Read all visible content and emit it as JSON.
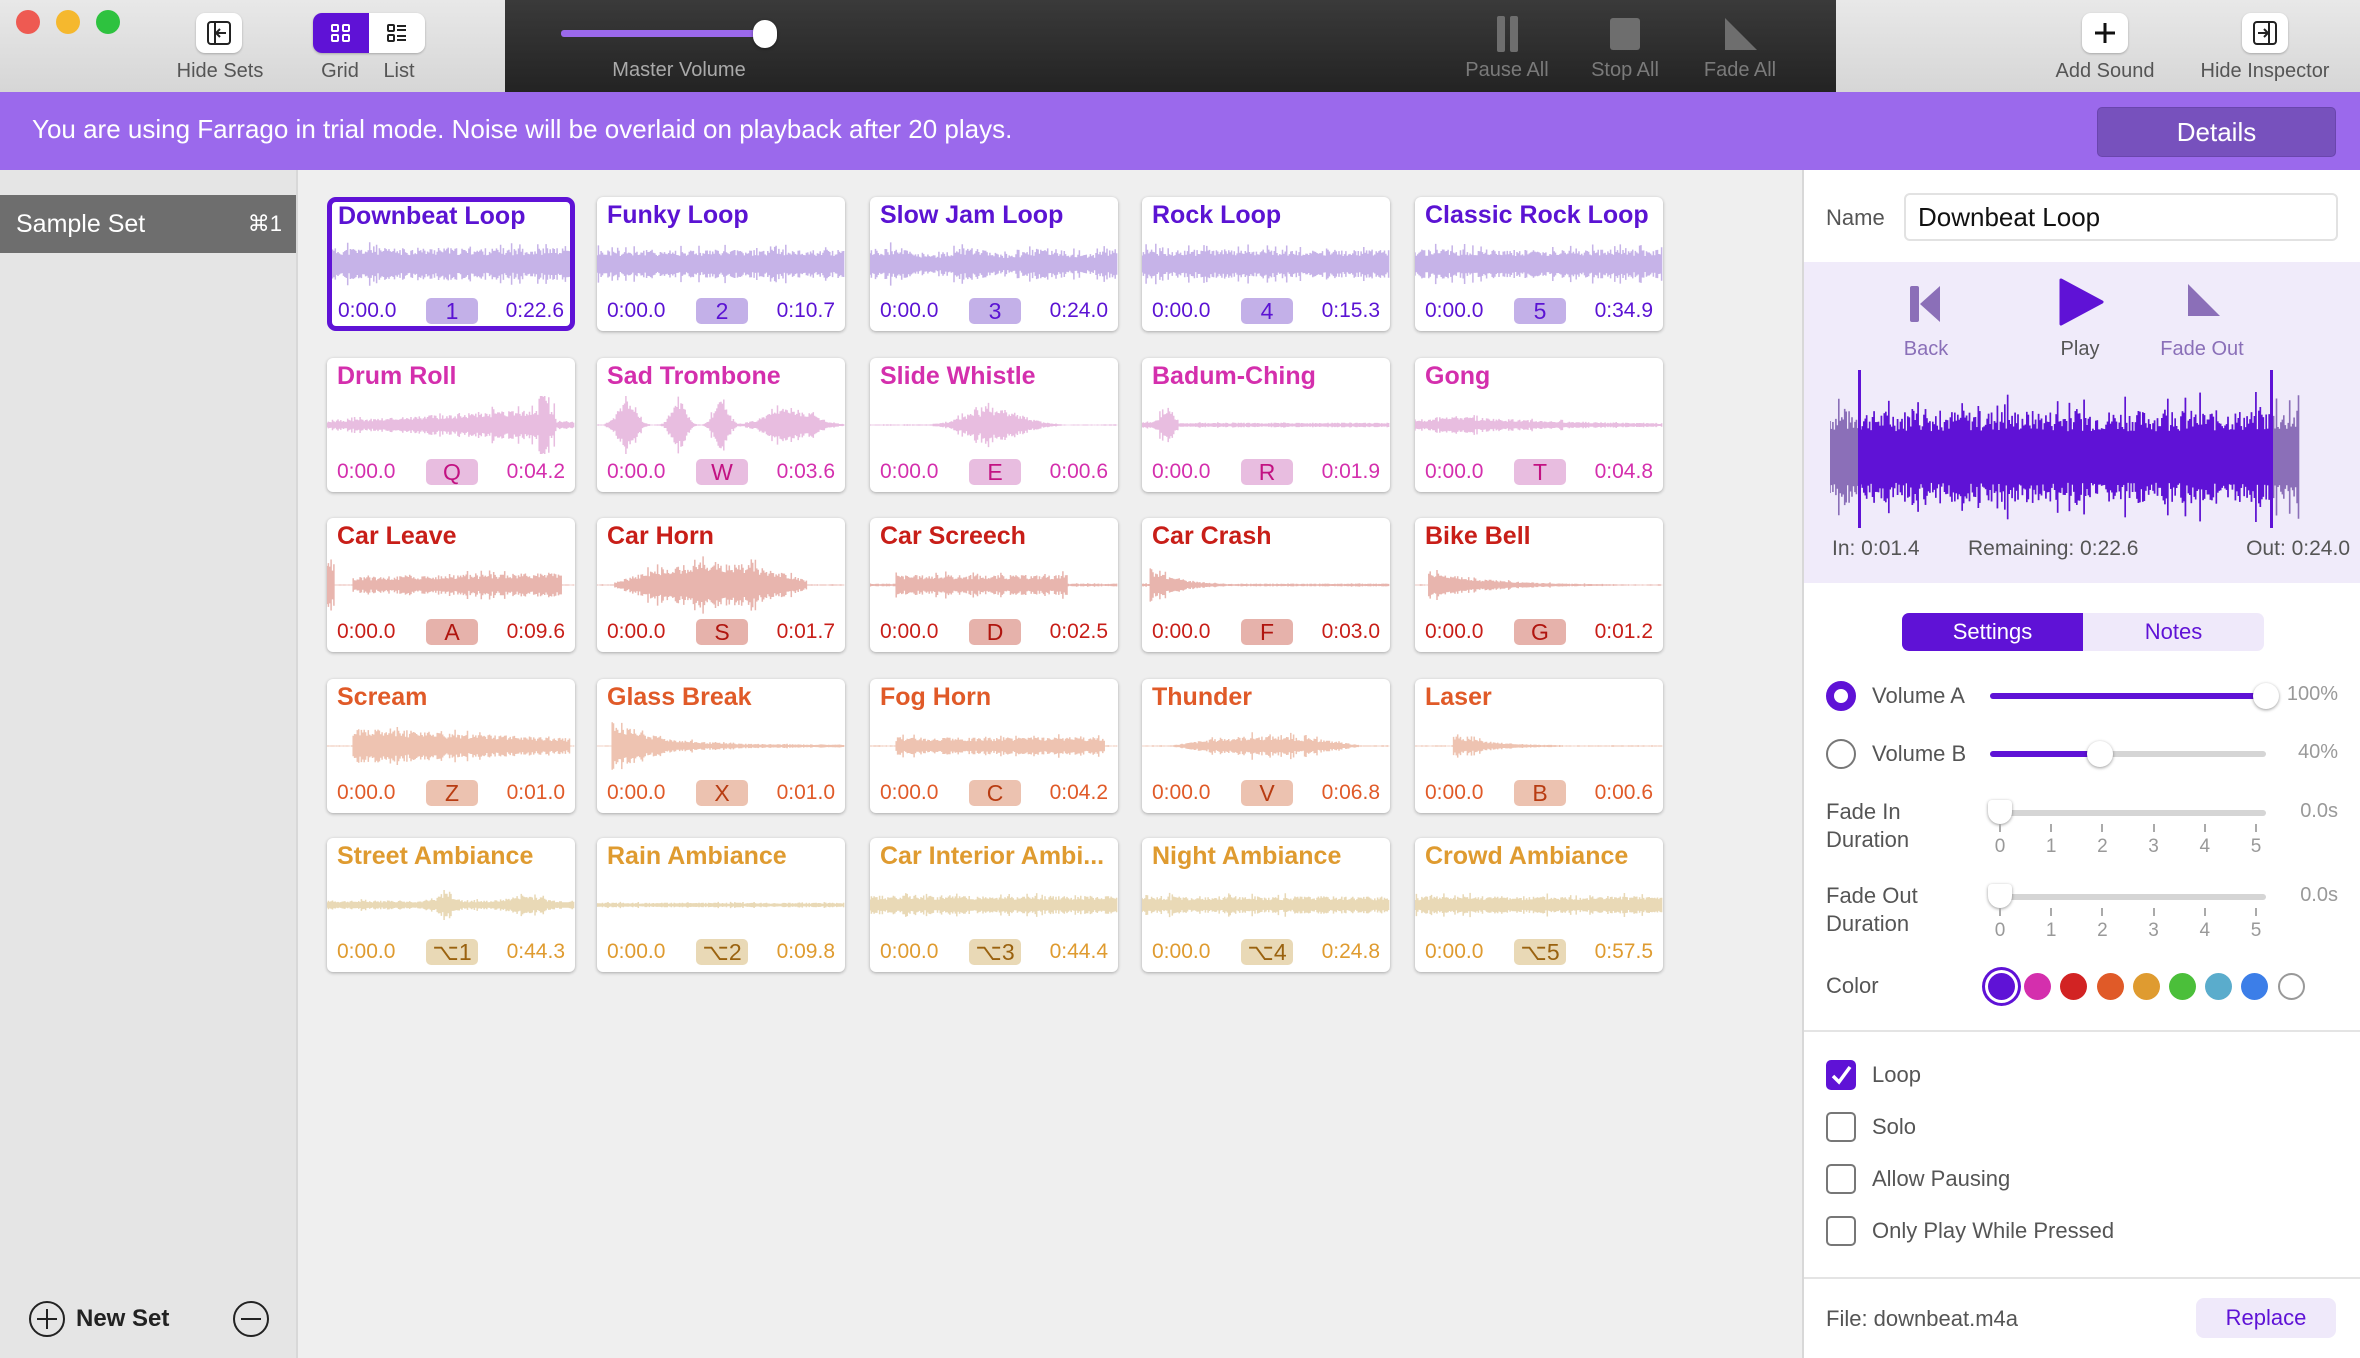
{
  "toolbar": {
    "hide_sets": "Hide Sets",
    "grid": "Grid",
    "list": "List",
    "master_volume": "Master Volume",
    "master_volume_value": 0.95,
    "pause_all": "Pause All",
    "stop_all": "Stop All",
    "fade_all": "Fade All",
    "add_sound": "Add Sound",
    "hide_inspector": "Hide Inspector"
  },
  "banner": {
    "text": "You are using Farrago in trial mode. Noise will be overlaid on playback after 20 plays.",
    "details": "Details"
  },
  "sidebar": {
    "sets": [
      {
        "name": "Sample Set",
        "shortcut": "⌘1"
      }
    ],
    "new_set": "New Set"
  },
  "colors": {
    "purple": {
      "text": "#5b13d3",
      "wave": "#c6b3e8",
      "key": "#c3b0e8",
      "keytext": "#5b13d3"
    },
    "pink": {
      "text": "#d42fad",
      "wave": "#e8bde0",
      "key": "#e8bde0",
      "keytext": "#c21282"
    },
    "red": {
      "text": "#c81e18",
      "wave": "#e8b5ae",
      "key": "#e6b2ab",
      "keytext": "#b0150f"
    },
    "orange": {
      "text": "#e05a28",
      "wave": "#eec3b1",
      "key": "#ecc2b0",
      "keytext": "#b83c12"
    },
    "yellow": {
      "text": "#df9b30",
      "wave": "#e9d9b6",
      "key": "#e9d9b6",
      "keytext": "#9a620f"
    }
  },
  "sounds": [
    {
      "name": "Downbeat Loop",
      "start": "0:00.0",
      "key": "1",
      "end": "0:22.6",
      "color": "purple",
      "selected": true
    },
    {
      "name": "Funky Loop",
      "start": "0:00.0",
      "key": "2",
      "end": "0:10.7",
      "color": "purple"
    },
    {
      "name": "Slow Jam Loop",
      "start": "0:00.0",
      "key": "3",
      "end": "0:24.0",
      "color": "purple"
    },
    {
      "name": "Rock Loop",
      "start": "0:00.0",
      "key": "4",
      "end": "0:15.3",
      "color": "purple"
    },
    {
      "name": "Classic Rock Loop",
      "start": "0:00.0",
      "key": "5",
      "end": "0:34.9",
      "color": "purple"
    },
    {
      "name": "Drum Roll",
      "start": "0:00.0",
      "key": "Q",
      "end": "0:04.2",
      "color": "pink"
    },
    {
      "name": "Sad Trombone",
      "start": "0:00.0",
      "key": "W",
      "end": "0:03.6",
      "color": "pink"
    },
    {
      "name": "Slide Whistle",
      "start": "0:00.0",
      "key": "E",
      "end": "0:00.6",
      "color": "pink"
    },
    {
      "name": "Badum-Ching",
      "start": "0:00.0",
      "key": "R",
      "end": "0:01.9",
      "color": "pink"
    },
    {
      "name": "Gong",
      "start": "0:00.0",
      "key": "T",
      "end": "0:04.8",
      "color": "pink"
    },
    {
      "name": "Car Leave",
      "start": "0:00.0",
      "key": "A",
      "end": "0:09.6",
      "color": "red"
    },
    {
      "name": "Car Horn",
      "start": "0:00.0",
      "key": "S",
      "end": "0:01.7",
      "color": "red"
    },
    {
      "name": "Car Screech",
      "start": "0:00.0",
      "key": "D",
      "end": "0:02.5",
      "color": "red"
    },
    {
      "name": "Car Crash",
      "start": "0:00.0",
      "key": "F",
      "end": "0:03.0",
      "color": "red"
    },
    {
      "name": "Bike Bell",
      "start": "0:00.0",
      "key": "G",
      "end": "0:01.2",
      "color": "red"
    },
    {
      "name": "Scream",
      "start": "0:00.0",
      "key": "Z",
      "end": "0:01.0",
      "color": "orange"
    },
    {
      "name": "Glass Break",
      "start": "0:00.0",
      "key": "X",
      "end": "0:01.0",
      "color": "orange"
    },
    {
      "name": "Fog Horn",
      "start": "0:00.0",
      "key": "C",
      "end": "0:04.2",
      "color": "orange"
    },
    {
      "name": "Thunder",
      "start": "0:00.0",
      "key": "V",
      "end": "0:06.8",
      "color": "orange"
    },
    {
      "name": "Laser",
      "start": "0:00.0",
      "key": "B",
      "end": "0:00.6",
      "color": "orange"
    },
    {
      "name": "Street Ambiance",
      "start": "0:00.0",
      "key": "⌥1",
      "end": "0:44.3",
      "color": "yellow"
    },
    {
      "name": "Rain Ambiance",
      "start": "0:00.0",
      "key": "⌥2",
      "end": "0:09.8",
      "color": "yellow"
    },
    {
      "name": "Car Interior Ambi...",
      "start": "0:00.0",
      "key": "⌥3",
      "end": "0:44.4",
      "color": "yellow"
    },
    {
      "name": "Night Ambiance",
      "start": "0:00.0",
      "key": "⌥4",
      "end": "0:24.8",
      "color": "yellow"
    },
    {
      "name": "Crowd Ambiance",
      "start": "0:00.0",
      "key": "⌥5",
      "end": "0:57.5",
      "color": "yellow"
    }
  ],
  "inspector": {
    "name_label": "Name",
    "name_value": "Downbeat Loop",
    "back": "Back",
    "play": "Play",
    "fade_out": "Fade Out",
    "in": "In: 0:01.4",
    "remaining": "Remaining: 0:22.6",
    "out": "Out: 0:24.0",
    "tabs": [
      {
        "label": "Settings",
        "active": true
      },
      {
        "label": "Notes"
      }
    ],
    "volume_a": {
      "label": "Volume A",
      "value": "100%",
      "level": 1.0,
      "selected": true
    },
    "volume_b": {
      "label": "Volume B",
      "value": "40%",
      "level": 0.4,
      "selected": false
    },
    "fade_in": {
      "label1": "Fade In",
      "label2": "Duration",
      "value": "0.0s"
    },
    "fade_out_dur": {
      "label1": "Fade Out",
      "label2": "Duration",
      "value": "0.0s"
    },
    "ticks": [
      "0",
      "1",
      "2",
      "3",
      "4",
      "5"
    ],
    "color_label": "Color",
    "swatches": [
      "#5f12d6",
      "#d42fad",
      "#d22323",
      "#e05a28",
      "#df9b30",
      "#4bbf3a",
      "#5aaccc",
      "#3c7ee8",
      "#ffffff"
    ],
    "selected_swatch": 0,
    "checkboxes": [
      {
        "label": "Loop",
        "checked": true
      },
      {
        "label": "Solo",
        "checked": false
      },
      {
        "label": "Allow Pausing",
        "checked": false
      },
      {
        "label": "Only Play While Pressed",
        "checked": false
      }
    ],
    "file": "File: downbeat.m4a",
    "replace": "Replace"
  }
}
